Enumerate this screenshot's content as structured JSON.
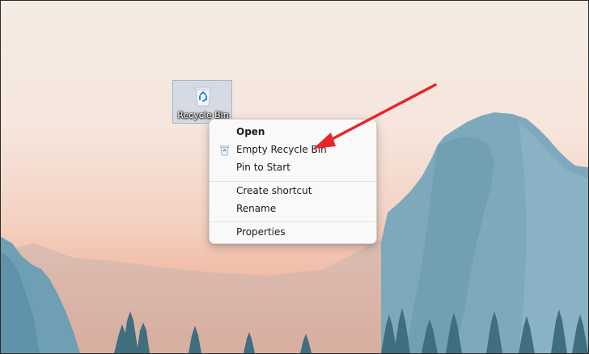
{
  "desktop": {
    "icon": {
      "name": "recycle-bin-icon",
      "label": "Recycle Bin",
      "selected": true
    }
  },
  "context_menu": {
    "items": [
      {
        "label": "Open",
        "bold": true,
        "icon": null
      },
      {
        "label": "Empty Recycle Bin",
        "bold": false,
        "icon": "recycle-bin-icon"
      },
      {
        "label": "Pin to Start",
        "bold": false,
        "icon": null
      },
      {
        "label": "Create shortcut",
        "bold": false,
        "icon": null
      },
      {
        "label": "Rename",
        "bold": false,
        "icon": null
      },
      {
        "label": "Properties",
        "bold": false,
        "icon": null
      }
    ]
  },
  "annotation": {
    "arrow_color": "#e8262a",
    "points_to": "Empty Recycle Bin"
  },
  "colors": {
    "menu_background": "#f9f9f9",
    "selection_highlight": "#cdd7e4",
    "recycle_symbol": "#1e8fd6"
  }
}
